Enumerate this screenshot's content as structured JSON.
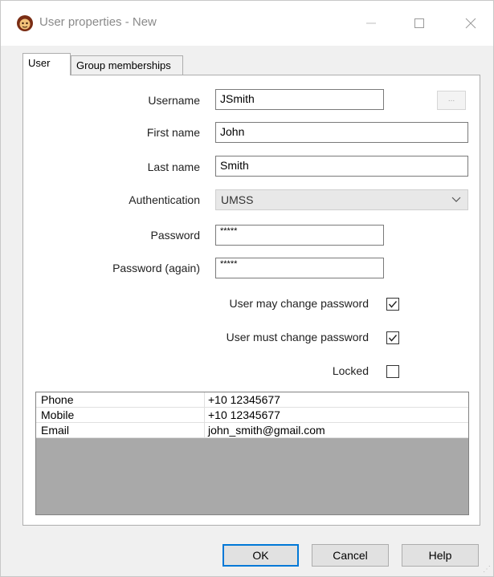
{
  "window": {
    "title": "User properties - New",
    "controls": {
      "minimize": "—",
      "maximize": "☐",
      "close": "✕"
    }
  },
  "tabs": [
    {
      "label": "User",
      "active": true
    },
    {
      "label": "Group memberships",
      "active": false
    }
  ],
  "form": {
    "username": {
      "label": "Username",
      "value": "JSmith",
      "browse_label": "..."
    },
    "first_name": {
      "label": "First name",
      "value": "John"
    },
    "last_name": {
      "label": "Last name",
      "value": "Smith"
    },
    "authentication": {
      "label": "Authentication",
      "value": "UMSS"
    },
    "password": {
      "label": "Password",
      "value": "*****"
    },
    "password_again": {
      "label": "Password (again)",
      "value": "*****"
    },
    "may_change": {
      "label": "User may change password",
      "checked": true
    },
    "must_change": {
      "label": "User must change password",
      "checked": true
    },
    "locked": {
      "label": "Locked",
      "checked": false
    }
  },
  "properties": [
    {
      "key": "Phone",
      "value": "+10 12345677"
    },
    {
      "key": "Mobile",
      "value": "+10 12345677"
    },
    {
      "key": "Email",
      "value": "john_smith@gmail.com"
    }
  ],
  "buttons": {
    "ok": "OK",
    "cancel": "Cancel",
    "help": "Help"
  },
  "icons": {
    "app": "app-face-icon",
    "dropdown": "chevron-down-icon",
    "check": "checkmark-icon",
    "grip": "resize-grip-icon"
  },
  "colors": {
    "accent": "#0078d7",
    "grid_empty": "#a9a9a9"
  }
}
